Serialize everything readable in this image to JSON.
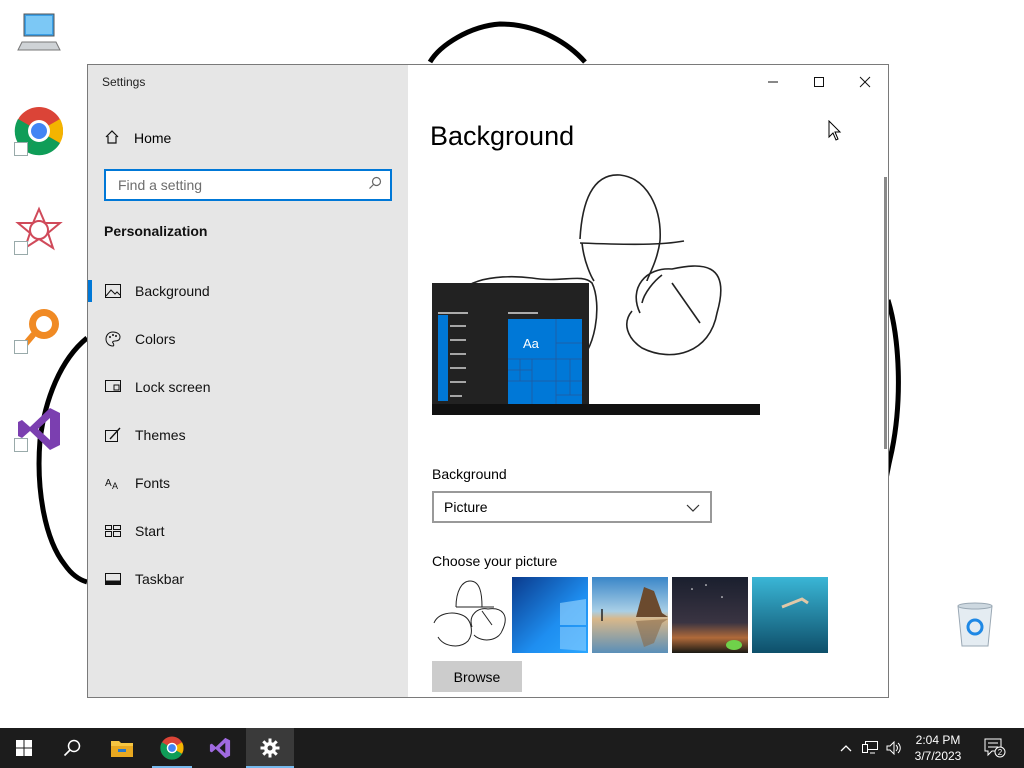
{
  "window": {
    "title": "Settings",
    "controls": [
      "minimize",
      "maximize",
      "close"
    ]
  },
  "sidebar": {
    "home_label": "Home",
    "search_placeholder": "Find a setting",
    "section_title": "Personalization",
    "items": [
      {
        "label": "Background",
        "icon": "picture-icon",
        "selected": true
      },
      {
        "label": "Colors",
        "icon": "palette-icon",
        "selected": false
      },
      {
        "label": "Lock screen",
        "icon": "lock-screen-icon",
        "selected": false
      },
      {
        "label": "Themes",
        "icon": "themes-icon",
        "selected": false
      },
      {
        "label": "Fonts",
        "icon": "fonts-icon",
        "selected": false
      },
      {
        "label": "Start",
        "icon": "start-icon",
        "selected": false
      },
      {
        "label": "Taskbar",
        "icon": "taskbar-icon",
        "selected": false
      }
    ]
  },
  "main": {
    "page_title": "Background",
    "preview_tile_text": "Aa",
    "background_label": "Background",
    "background_value": "Picture",
    "choose_picture_label": "Choose your picture",
    "pictures": [
      "scribble",
      "windows-blue",
      "beach-rocks",
      "night-sky",
      "underwater-swimmer"
    ],
    "browse_label": "Browse"
  },
  "taskbar": {
    "apps": [
      "start",
      "search",
      "file-explorer",
      "chrome",
      "visual-studio",
      "settings"
    ],
    "active_app": "settings",
    "time": "2:04 PM",
    "date": "3/7/2023",
    "notification_count": "2"
  },
  "desktop": {
    "icons": [
      "this-pc",
      "google-chrome",
      "app-shortcut",
      "search-app-shortcut",
      "visual-studio",
      "recycle-bin"
    ]
  },
  "colors": {
    "accent": "#0078d7",
    "sidebar_bg": "#e6e6e6",
    "taskbar_bg": "#1c1c1c"
  }
}
